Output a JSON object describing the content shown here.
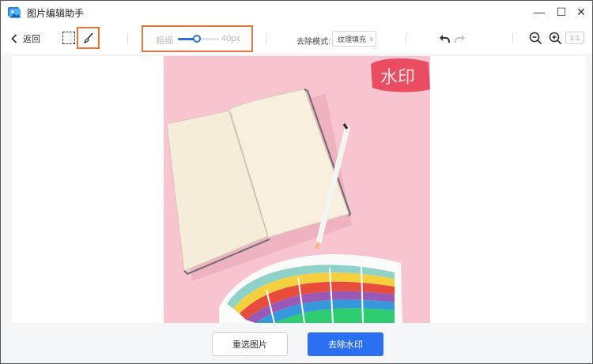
{
  "app": {
    "title": "图片编辑助手"
  },
  "window_controls": {
    "minimize": "—",
    "maximize": "☐",
    "close": "✕"
  },
  "toolbar": {
    "back_label": "返回",
    "brush_size": {
      "label": "粗细",
      "value_text": "40px",
      "fraction": 0.46
    },
    "mode": {
      "label": "去除模式:",
      "selected": "纹理填充"
    },
    "ratio_label": "1:1",
    "icons": {
      "back": "chevron-left-icon",
      "select": "rectangle-select-icon",
      "brush": "brush-icon",
      "undo": "undo-icon",
      "redo": "redo-icon",
      "zoom_out": "zoom-out-icon",
      "zoom_in": "zoom-in-icon"
    }
  },
  "canvas": {
    "watermark_text": "水印",
    "colors": {
      "background": "#f7c4cf",
      "highlight": "#e8374d"
    }
  },
  "actions": {
    "reselect": "重选图片",
    "remove": "去除水印"
  },
  "colors": {
    "accent": "#2a6ff2",
    "tool_highlight": "#e8743b"
  }
}
